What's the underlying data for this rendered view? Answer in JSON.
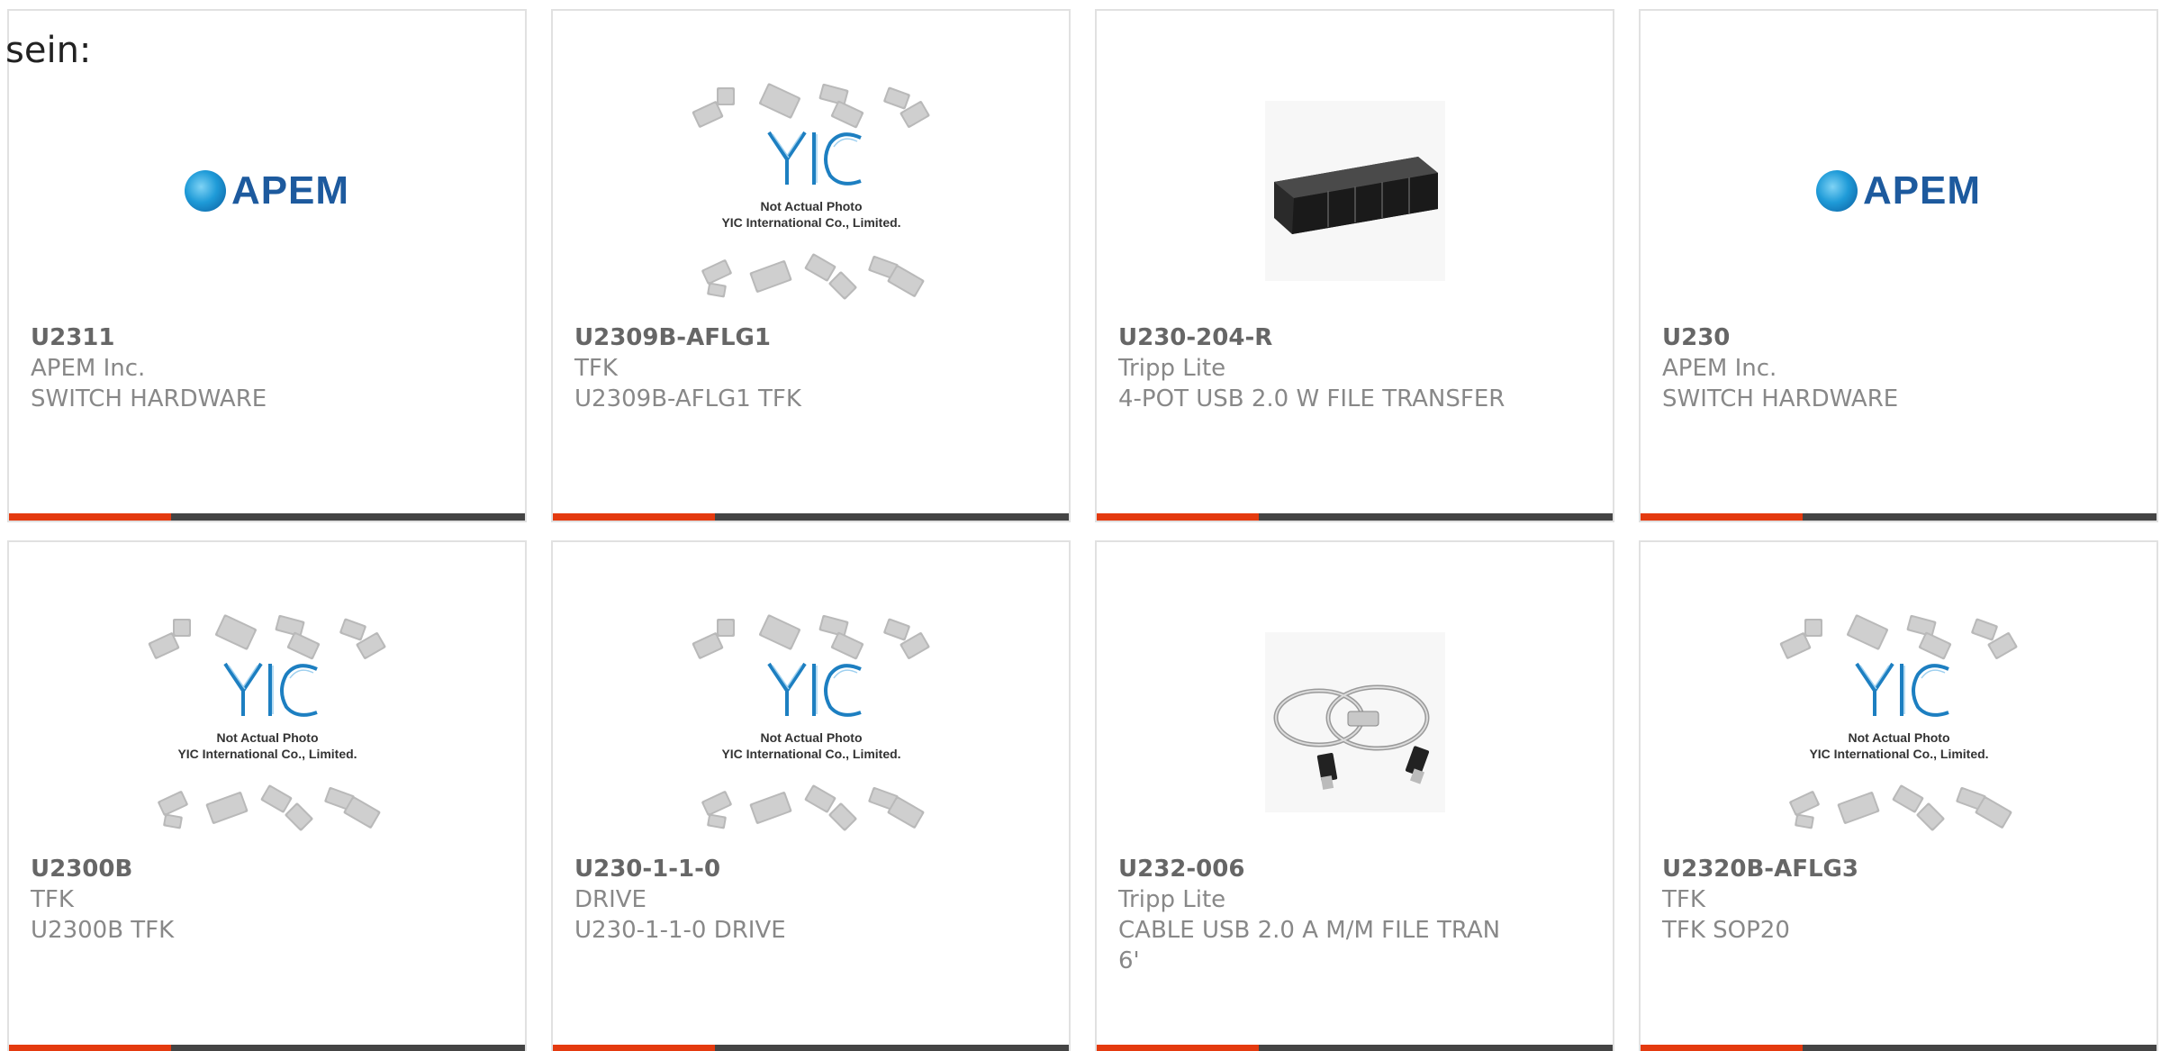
{
  "stray_label": "sein:",
  "colors": {
    "accent": "#e43a0f",
    "bar": "#444444",
    "part_text": "#666666",
    "meta_text": "#888888",
    "border": "#e1e1e1"
  },
  "yic_caption": {
    "line1": "Not Actual Photo",
    "line2": "YIC International Co., Limited."
  },
  "apem_logo_text": "APEM",
  "products": [
    {
      "part": "U2311",
      "manufacturer": "APEM Inc.",
      "description": "SWITCH HARDWARE",
      "image": "apem-logo"
    },
    {
      "part": "U2309B-AFLG1",
      "manufacturer": "TFK",
      "description": "U2309B-AFLG1 TFK",
      "image": "yic-placeholder"
    },
    {
      "part": "U230-204-R",
      "manufacturer": "Tripp Lite",
      "description": "4-POT USB 2.0 W FILE TRANSFER",
      "image": "usb-hub-photo"
    },
    {
      "part": "U230",
      "manufacturer": "APEM Inc.",
      "description": "SWITCH HARDWARE",
      "image": "apem-logo"
    },
    {
      "part": "U2300B",
      "manufacturer": "TFK",
      "description": "U2300B TFK",
      "image": "yic-placeholder"
    },
    {
      "part": "U230-1-1-0",
      "manufacturer": "DRIVE",
      "description": "U230-1-1-0 DRIVE",
      "image": "yic-placeholder"
    },
    {
      "part": "U232-006",
      "manufacturer": "Tripp Lite",
      "description": "CABLE USB 2.0 A M/M FILE TRAN 6'",
      "image": "usb-cable-photo"
    },
    {
      "part": "U2320B-AFLG3",
      "manufacturer": "TFK",
      "description": "TFK SOP20",
      "image": "yic-placeholder"
    }
  ]
}
